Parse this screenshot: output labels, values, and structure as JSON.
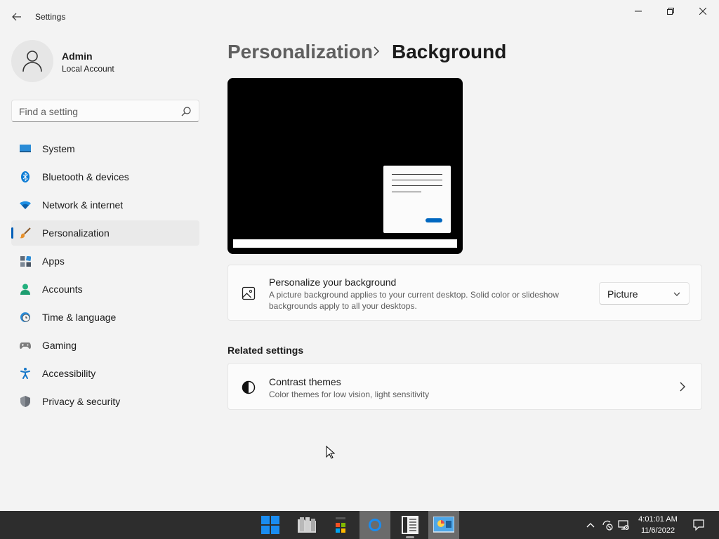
{
  "window": {
    "title": "Settings",
    "controls": [
      "minimize",
      "maximize",
      "close"
    ]
  },
  "profile": {
    "name": "Admin",
    "account_type": "Local Account"
  },
  "search": {
    "placeholder": "Find a setting",
    "value": ""
  },
  "sidebar": {
    "items": [
      {
        "label": "System",
        "icon": "system-icon",
        "active": false
      },
      {
        "label": "Bluetooth & devices",
        "icon": "bluetooth-icon",
        "active": false
      },
      {
        "label": "Network & internet",
        "icon": "wifi-icon",
        "active": false
      },
      {
        "label": "Personalization",
        "icon": "brush-icon",
        "active": true
      },
      {
        "label": "Apps",
        "icon": "apps-icon",
        "active": false
      },
      {
        "label": "Accounts",
        "icon": "person-icon",
        "active": false
      },
      {
        "label": "Time & language",
        "icon": "clock-globe-icon",
        "active": false
      },
      {
        "label": "Gaming",
        "icon": "gamepad-icon",
        "active": false
      },
      {
        "label": "Accessibility",
        "icon": "accessibility-icon",
        "active": false
      },
      {
        "label": "Privacy & security",
        "icon": "shield-icon",
        "active": false
      }
    ]
  },
  "header": {
    "parent": "Personalization",
    "separator": "chevron-right-icon",
    "current": "Background"
  },
  "background_card": {
    "title": "Personalize your background",
    "description_line1": "A picture background applies to your current desktop. Solid color or slideshow",
    "description_line2": "backgrounds apply to all your desktops.",
    "icon": "image-icon",
    "dropdown_value": "Picture"
  },
  "related": {
    "heading": "Related settings",
    "items": [
      {
        "title": "Contrast themes",
        "description": "Color themes for low vision, light sensitivity",
        "icon": "contrast-icon"
      }
    ]
  },
  "taskbar": {
    "apps": [
      "start-icon",
      "file-explorer-icon",
      "store-icon",
      "cortana-icon",
      "settings-app-icon",
      "control-panel-icon"
    ],
    "clock_time": "4:01:01 AM",
    "clock_date": "11/6/2022"
  },
  "colors": {
    "accent": "#005fb8",
    "page_bg": "#f3f3f3",
    "card_bg": "#fbfbfb",
    "taskbar_bg": "#2d2d2d"
  }
}
